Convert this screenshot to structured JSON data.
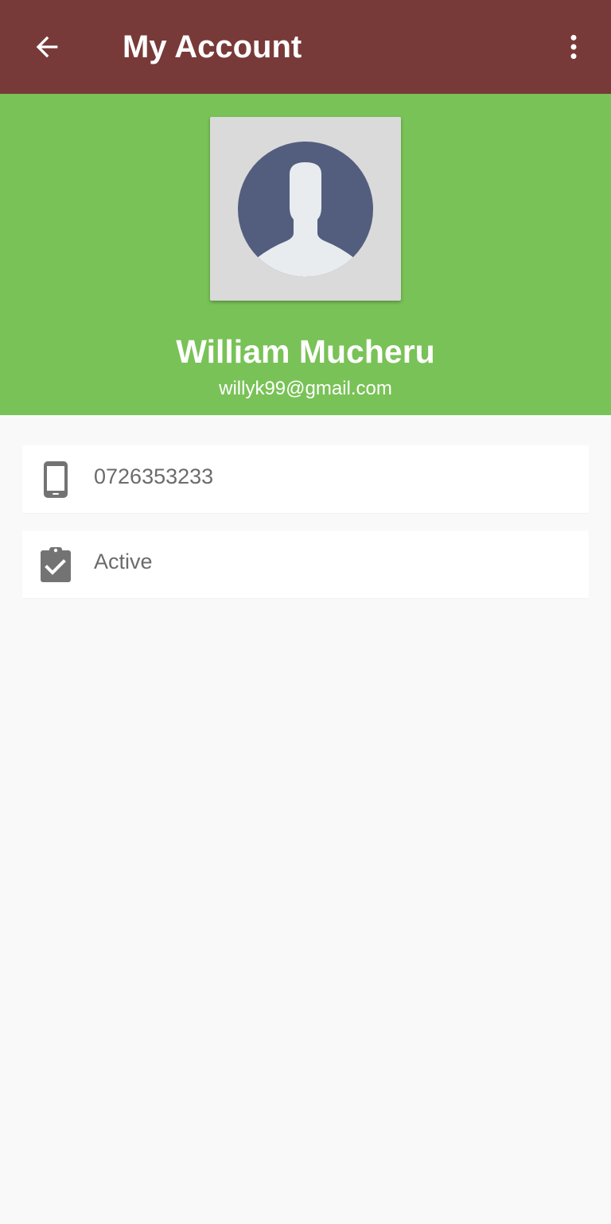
{
  "app_bar": {
    "title": "My Account",
    "background_color": "#783a38",
    "back_icon": "arrow-left-icon",
    "menu_icon": "more-vertical-icon"
  },
  "profile": {
    "background_color": "#79c257",
    "avatar_icon": "user-placeholder-icon",
    "name": "William Mucheru",
    "email": "willyk99@gmail.com"
  },
  "details": {
    "phone": {
      "icon": "smartphone-icon",
      "value": "0726353233"
    },
    "status": {
      "icon": "clipboard-check-icon",
      "value": "Active"
    }
  }
}
